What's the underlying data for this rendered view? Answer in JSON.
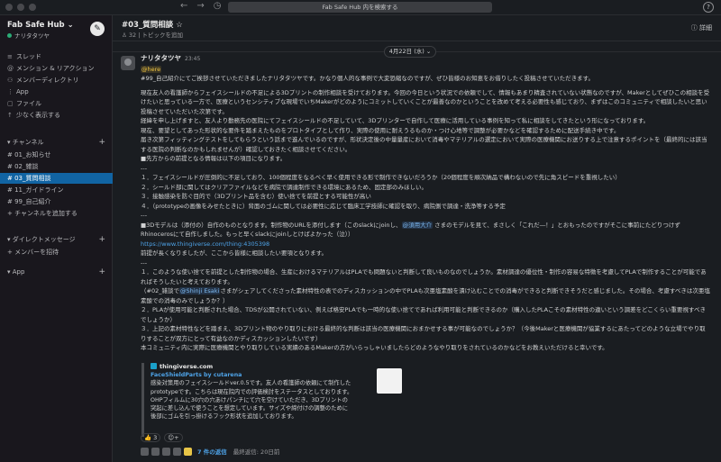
{
  "search": {
    "placeholder": "Fab Safe Hub 内を検索する"
  },
  "workspace": {
    "name": "Fab Safe Hub ⌄",
    "user": "ナリタタツヤ"
  },
  "sidebar": {
    "top_items": [
      {
        "icon": "≡",
        "label": "スレッド"
      },
      {
        "icon": "@",
        "label": "メンション & リアクション"
      },
      {
        "icon": "⚇",
        "label": "メンバーディレクトリ"
      },
      {
        "icon": "⋮",
        "label": "App"
      },
      {
        "icon": "▢",
        "label": "ファイル"
      },
      {
        "icon": "↑",
        "label": "少なく表示する"
      }
    ],
    "channels_header": "▾ チャンネル",
    "channels": [
      {
        "label": "# 01_お知らせ"
      },
      {
        "label": "# 02_雑談"
      },
      {
        "label": "# 03_質問相談"
      },
      {
        "label": "# 11_ガイドライン"
      },
      {
        "label": "# 99_自己紹介"
      },
      {
        "label": "+ チャンネルを追加する"
      }
    ],
    "dm_header": "▾ ダイレクトメッセージ",
    "dm_add": "+ メンバーを招待",
    "apps_header": "▾ App",
    "plus": "+"
  },
  "channel": {
    "title": "#03_質問相談 ☆",
    "meta": "♙ 32 | トピックを追加",
    "details": "ⓘ 詳細"
  },
  "date_divider": "4月22日 (水) ⌄",
  "message": {
    "author": "ナリタタツヤ",
    "time": "23:45",
    "mention_here": "@here",
    "lines": [
      "#99_自己紹介にてご挨拶させていただきましたナリタタツヤです。かなり個人的な事例で大変恐縮なのですが、ぜひ皆様のお知恵をお借りしたく投稿させていただきます。",
      "",
      "現在友人の看護師からフェイスシールドの不足による3Dプリントの制作相談を受けております。今回の今日という状況での依頼でして、情報もあまり精査されていない状態なのですが、Makerとしてぜひこの相談を受けたいと思っている一方で、医療というセンシティブな現場でいちMakerがどのようにコミットしていくことが最善なのかということを改めて考える必要性も感じており、まずはこのコミュニティで相談したいと思い投稿させていただいた次第です。",
      "経緯を申し上げますと、友人より勤務先の医院にてフェイスシールドの不足していて、3Dプリンターで自作して医療に活用している事例を知って私に相談をしてきたという形になっております。",
      "現在、要望としてあった形状的な要件を踏まえたものをプロトタイプとして作り、実際の使用に耐えうるものか・つけ心地等で調整が必要かなどを確認するために配送手続き中です。",
      "届き次第フィッティングテストをしてもらうという話まで進んでいるのですが、形状決定後の中量量産において消毒やマテリアルの選定において実際の医療機関にお送りする上で注意するポイントを（最終的には該当する医院の判断なのかもしれませんが）確認しておきたく相談させてください。",
      "■先方からの前提となる情報は以下の項目になります。",
      "---",
      "１．フェイスシールドが圧倒的に不足しており、100個程度をなるべく早く使用できる形で制作できないだろうか（20個程度を順次納品で構わないので先に角スピードを重視したい）",
      "２．シールド部に関してはクリアファイルなどを病院で調達制作できる環境にあるため、固定部のみほしい。",
      "３．接触感染を防ぐ目的で（3Dプリント品を含む）使い捨てを前提とする可能性が高い",
      "４．（prototypeの画像をみせたときに）背面のゴムに関しては必要性に応じて臨床工学技師に確認を取り、病院側で調達・洗浄等する予定",
      "---",
      "■3Dモデルは（添付の）自作のものとなります。制作物のURLを添付します（このslackにjoinし、",
      "Rhinocerosにて自作しました。もっと早くslackにjoinしとけばよかった（泣））",
      "https://www.thingiverse.com/thing:4305398",
      "前提が長くなりましたが、ここから皆様に相談したい要項となります。",
      "---",
      "１．このような使い捨てを前提とした制作物の場合、生産におけるマテリアルはPLAでも問題ないと判断して良いものなのでしょうか。素材調達の優位性・制作の容易な特徴を考慮してPLAで制作することが可能であればそうしたいと考えております。",
      "（#02_雑談で",
      "さまがシェアしてくださった素材特性の表でのディスカッションの中でPLAも次亜塩素酸を漬け込むことでの消毒ができると判断できそうだと感じました。その場合、考慮すべきは次亜塩素酸での消毒のみでしょうか？）",
      "２．PLAが使用可能と判断された場合、TDSが公開されていない、例えば格安PLAでも一時的な使い捨てであれば利用可能と判断できるのか（購入したPLAこその素材特性の違いという調差をどこくらい重要視すべきでしょうか）",
      "３．上記の素材特性などを踏まえ、3Dプリント物のやり取りにおける最終的な判断は該当の医療機関におまかせする事が可能なのでしょうか？（今後Makerと医療機関が協業するにあたってどのような立場でやり取りすることが双方にとって有益なのかディスカッションしたいです）",
      "本コミュニティ内に実際に医療機関とやり取りしている実績のあるMakerの方がいらっしゃいましたらどのようなやり取りをされているのかなどをお教えいただけると幸いです。"
    ],
    "mention_user_1": "@須用大介",
    "after_mention_1": " さまのモデルを見て、まさしく「これだ―！」とおもったのですがそこに事前にたどりつけず",
    "mention_user_2": "@Shinji Esaki"
  },
  "unfurl": {
    "site": "thingiverse.com",
    "title": "FaceShieldParts by cutarena",
    "body": [
      "感染対策用のフェイスシールドver.0.5です。友人の看護師の依頼にて制作した",
      "prototypeです。こちらは現在院内での評価検討をステータスとしております。",
      "OHPフィルムに30穴の穴あけパンチにて穴を空けていただき、3Dプリントの",
      "突起に差し込んで使うことを想定しています。サイズや締付けの調整のために",
      "後部にゴムを引っ掛けるフック形状を追加しております。"
    ]
  },
  "reactions": [
    "👍 3",
    "☺+"
  ],
  "thread": {
    "replies": "7 件の返信",
    "last": "最終返信: 20日前"
  }
}
